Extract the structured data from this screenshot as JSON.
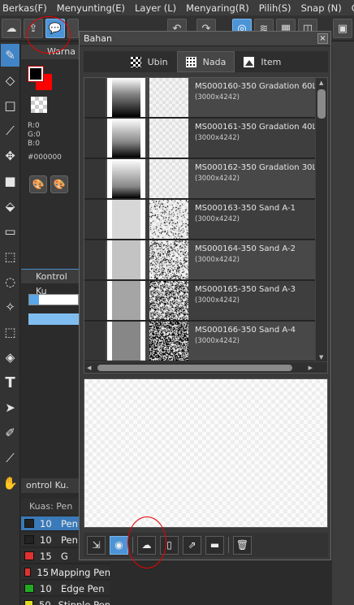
{
  "menu": [
    "Berkas(F)",
    "Menyunting(E)",
    "Layer (L)",
    "Menyaring(R)",
    "Pilih(S)",
    "Snap (N)",
    "Co"
  ],
  "color_panel": {
    "tab": "Warna",
    "r": "R:0",
    "g": "G:0",
    "b": "B:0",
    "hex": "#000000"
  },
  "control_panel": {
    "title": "Kontrol Ku"
  },
  "control_panel2": {
    "title": "ontrol Ku."
  },
  "brush_panel": {
    "header": "Kuas: Pen",
    "rows": [
      {
        "size": "10",
        "name": "Pen",
        "color": "#222222",
        "selected": true
      },
      {
        "size": "10",
        "name": "Pen",
        "color": "#222222",
        "selected": false
      },
      {
        "size": "15",
        "name": "G",
        "color": "#e03030",
        "selected": false
      },
      {
        "size": "15",
        "name": "Mapping Pen",
        "color": "#e03030",
        "selected": false
      },
      {
        "size": "10",
        "name": "Edge Pen",
        "color": "#22aa22",
        "selected": false
      },
      {
        "size": "50",
        "name": "Stipple Pen",
        "color": "#dddd22",
        "selected": false
      }
    ]
  },
  "dialog": {
    "title": "Bahan",
    "close": "×",
    "tabs": [
      {
        "label": "Ubin",
        "icon": "checker-icon",
        "active": false
      },
      {
        "label": "Nada",
        "icon": "halftone-icon",
        "active": true
      },
      {
        "label": "Item",
        "icon": "image-icon",
        "active": false
      }
    ],
    "materials": [
      {
        "name": "MS000160-350 Gradation 60L",
        "size": "(3000x4242)",
        "kind": "grad",
        "density": 0.6
      },
      {
        "name": "MS000161-350 Gradation 40L",
        "size": "(3000x4242)",
        "kind": "grad",
        "density": 0.4
      },
      {
        "name": "MS000162-350 Gradation 30L",
        "size": "(3000x4242)",
        "kind": "grad",
        "density": 0.3
      },
      {
        "name": "MS000163-350 Sand A-1",
        "size": "(3000x4242)",
        "kind": "sand",
        "density": 0.1
      },
      {
        "name": "MS000164-350 Sand A-2",
        "size": "(3000x4242)",
        "kind": "sand",
        "density": 0.2
      },
      {
        "name": "MS000165-350 Sand A-3",
        "size": "(3000x4242)",
        "kind": "sand",
        "density": 0.35
      },
      {
        "name": "MS000166-350 Sand A-4",
        "size": "(3000x4242)",
        "kind": "sand",
        "density": 0.5
      }
    ]
  },
  "colors": {
    "accent": "#4c94d6",
    "annotation": "#e00000"
  }
}
